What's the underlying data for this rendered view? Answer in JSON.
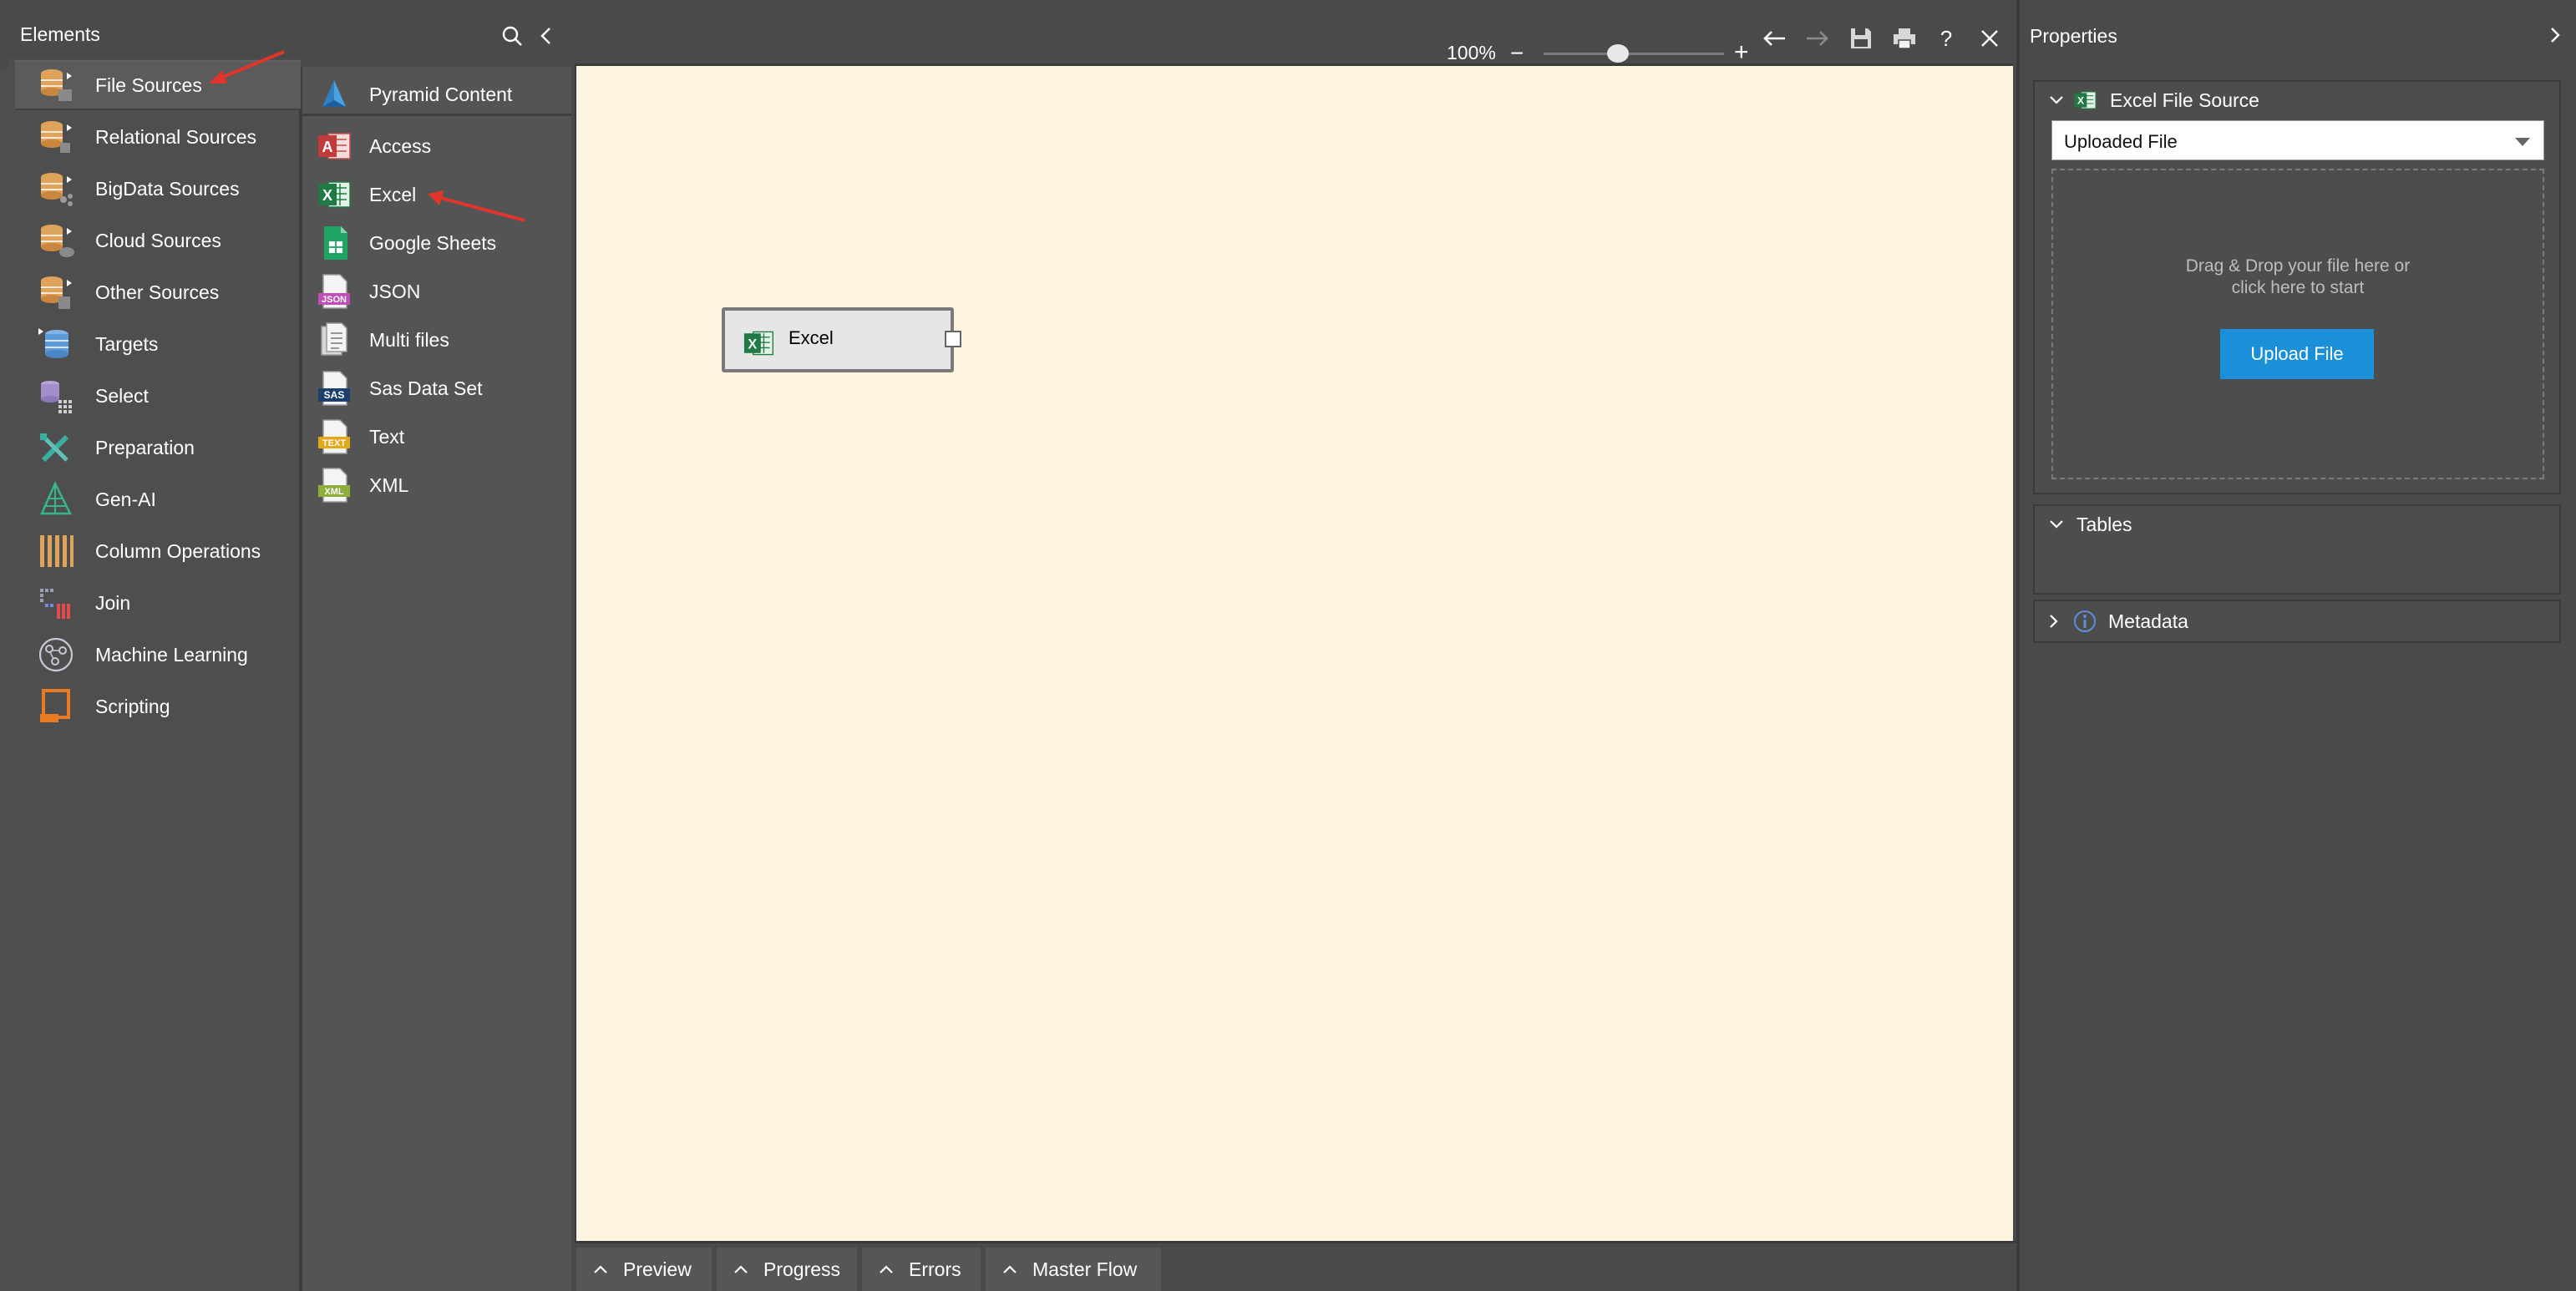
{
  "elements_panel": {
    "title": "Elements",
    "categories": [
      {
        "label": "File Sources",
        "icon": "file-sources-icon",
        "selected": true
      },
      {
        "label": "Relational Sources",
        "icon": "relational-sources-icon"
      },
      {
        "label": "BigData Sources",
        "icon": "bigdata-sources-icon"
      },
      {
        "label": "Cloud Sources",
        "icon": "cloud-sources-icon"
      },
      {
        "label": "Other Sources",
        "icon": "other-sources-icon"
      },
      {
        "label": "Targets",
        "icon": "targets-icon"
      },
      {
        "label": "Select",
        "icon": "select-icon"
      },
      {
        "label": "Preparation",
        "icon": "preparation-icon"
      },
      {
        "label": "Gen-AI",
        "icon": "gen-ai-icon"
      },
      {
        "label": "Column Operations",
        "icon": "column-operations-icon"
      },
      {
        "label": "Join",
        "icon": "join-icon"
      },
      {
        "label": "Machine Learning",
        "icon": "machine-learning-icon"
      },
      {
        "label": "Scripting",
        "icon": "scripting-icon"
      }
    ],
    "file_sources": [
      {
        "label": "Pyramid Content",
        "icon": "pyramid-icon"
      },
      {
        "label": "Access",
        "icon": "access-icon"
      },
      {
        "label": "Excel",
        "icon": "excel-icon"
      },
      {
        "label": "Google Sheets",
        "icon": "google-sheets-icon"
      },
      {
        "label": "JSON",
        "icon": "json-icon"
      },
      {
        "label": "Multi files",
        "icon": "multi-files-icon"
      },
      {
        "label": "Sas Data Set",
        "icon": "sas-icon"
      },
      {
        "label": "Text",
        "icon": "text-file-icon"
      },
      {
        "label": "XML",
        "icon": "xml-icon"
      }
    ]
  },
  "icon_badges": {
    "access": "A",
    "excel": "X",
    "json": "JSON",
    "sas": "SAS",
    "text": "TEXT",
    "xml": "XML"
  },
  "toolbar": {
    "zoom": "100%",
    "zoom_minus": "−",
    "zoom_plus": "+",
    "help": "?"
  },
  "canvas": {
    "node_label": "Excel"
  },
  "bottom_tabs": [
    "Preview",
    "Progress",
    "Errors",
    "Master Flow"
  ],
  "properties": {
    "title": "Properties",
    "source_section": "Excel File Source",
    "source_type": "Uploaded File",
    "dropzone_text_line1": "Drag & Drop your file here or",
    "dropzone_text_line2": "click here to start",
    "upload_button": "Upload File",
    "tables_section": "Tables",
    "metadata_section": "Metadata"
  },
  "colors": {
    "canvas_bg": "#fef5e0",
    "panel_bg": "#4e4e4e",
    "upload_button": "#1b90d8",
    "excel_green": "#1f7a45",
    "annotation_arrow": "#e0352b"
  }
}
